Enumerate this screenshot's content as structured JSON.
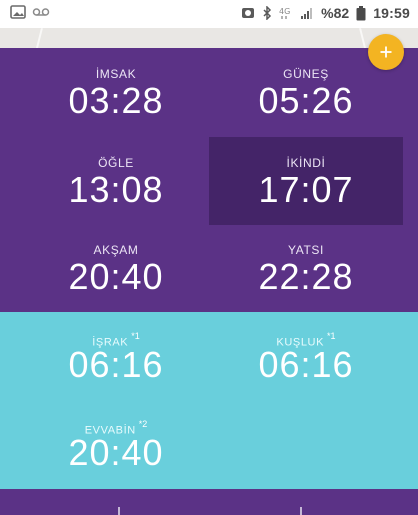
{
  "status_bar": {
    "left_icons": [
      "image-notification-icon",
      "voicemail-icon"
    ],
    "right_icons": [
      "alarm-icon",
      "bluetooth-icon",
      "network-icon",
      "signal-icon",
      "battery-icon"
    ],
    "battery": "%82",
    "time": "19:59"
  },
  "fab": {
    "label": "+"
  },
  "prayer_times": [
    {
      "label": "İMSAK",
      "time": "03:28"
    },
    {
      "label": "GÜNEŞ",
      "time": "05:26"
    },
    {
      "label": "ÖĞLE",
      "time": "13:08"
    },
    {
      "label": "İKİNDİ",
      "time": "17:07",
      "highlighted": true
    },
    {
      "label": "AKŞAM",
      "time": "20:40"
    },
    {
      "label": "YATSI",
      "time": "22:28"
    }
  ],
  "extra_times": [
    {
      "label": "İŞRAK",
      "note": "*1",
      "time": "06:16"
    },
    {
      "label": "KUŞLUK",
      "note": "*1",
      "time": "06:16"
    },
    {
      "label": "EVVABİN",
      "note": "*2",
      "time": "20:40"
    }
  ],
  "colors": {
    "purple": "#5b3286",
    "highlight": "#442468",
    "teal": "#69cfdc",
    "fab": "#f3b422",
    "top_band": "#e9e7e4"
  }
}
